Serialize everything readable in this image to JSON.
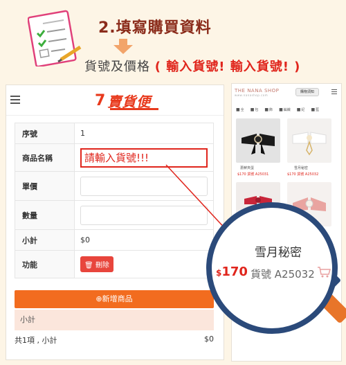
{
  "header": {
    "step_title": "2.填寫購買資料",
    "subtitle_prefix": "貨號及價格",
    "subtitle_emphasis": "( 輸入貨號!  輸入貨號! )"
  },
  "app": {
    "logo_seven": "7",
    "logo_text": "賣貨便"
  },
  "form": {
    "rows": [
      {
        "label": "序號",
        "value": "1"
      },
      {
        "label": "商品名稱",
        "value": "請輸入貨號!!!"
      },
      {
        "label": "單價",
        "value": ""
      },
      {
        "label": "數量",
        "value": ""
      },
      {
        "label": "小計",
        "value": "$0"
      },
      {
        "label": "功能",
        "value": "刪除"
      }
    ],
    "add_button": "⊕新增商品",
    "subtotal_bar": "小計",
    "total_left": "共1項 , 小計",
    "total_right": "$0"
  },
  "shop": {
    "logo": "THE NANA SHOP",
    "logo_sub": "www.nanashop.com",
    "button": "購物須知",
    "categories": [
      "全",
      "包",
      "飾",
      "編織",
      "紀",
      "藍"
    ],
    "products": [
      {
        "name": "蔥鮮夾蛋",
        "price": "$170",
        "code": "貨號 A25031"
      },
      {
        "name": "雪月秘密",
        "price": "$170",
        "code": "貨號 A25032"
      }
    ]
  },
  "magnifier": {
    "name": "雪月秘密",
    "price_symbol": "$",
    "price": "170",
    "code": "貨號 A25032"
  },
  "colors": {
    "accent_red": "#e0251c",
    "orange": "#f26c1f",
    "navy": "#2b4a7a",
    "title_brown": "#8b2c1b"
  }
}
